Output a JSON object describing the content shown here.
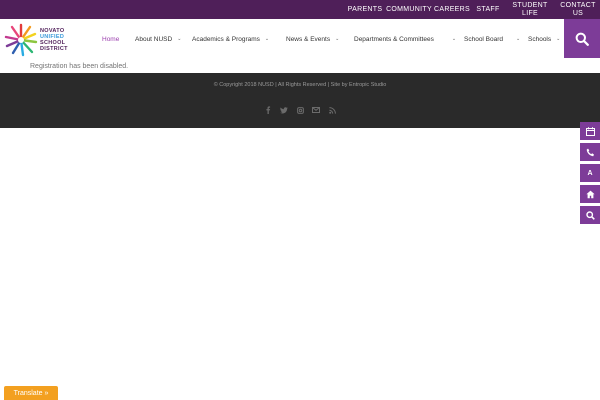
{
  "top_nav": {
    "items": [
      {
        "label": "PARENTS"
      },
      {
        "label": "COMMUNITY"
      },
      {
        "label": "CAREERS"
      },
      {
        "label": "STAFF"
      },
      {
        "label": "STUDENT LIFE"
      },
      {
        "label": "CONTACT US"
      }
    ]
  },
  "logo": {
    "lines": [
      "NOVATO",
      "UNIFIED",
      "SCHOOL",
      "DISTRICT"
    ]
  },
  "main_nav": {
    "items": [
      {
        "label": "Home",
        "active": true
      },
      {
        "label": "About NUSD",
        "has_dropdown": true
      },
      {
        "label": "Academics & Programs",
        "has_dropdown": true
      },
      {
        "label": "News & Events",
        "has_dropdown": true
      },
      {
        "label": "Departments & Committees",
        "has_dropdown": true
      },
      {
        "label": "School Board",
        "has_dropdown": true
      },
      {
        "label": "Schools",
        "has_dropdown": true
      }
    ]
  },
  "message": "Registration has been disabled.",
  "footer": {
    "copyright": "© Copyright 2018 NUSD | All Rights Reserved | Site by Entropic Studio",
    "social_icons": [
      "facebook-icon",
      "twitter-icon",
      "instagram-icon",
      "email-icon",
      "rss-icon"
    ]
  },
  "side_buttons": [
    {
      "icon": "calendar-icon"
    },
    {
      "icon": "phone-icon"
    },
    {
      "icon": "font-size-icon",
      "label": "A"
    },
    {
      "icon": "home-icon"
    },
    {
      "icon": "search-icon"
    }
  ],
  "translate": {
    "label": "Translate »"
  },
  "colors": {
    "brand_purple": "#7d3c98",
    "topbar_purple": "#4f1f59",
    "footer_bg": "#2a2a2a",
    "translate_orange": "#f3a020",
    "active_nav": "#9b3fae"
  }
}
